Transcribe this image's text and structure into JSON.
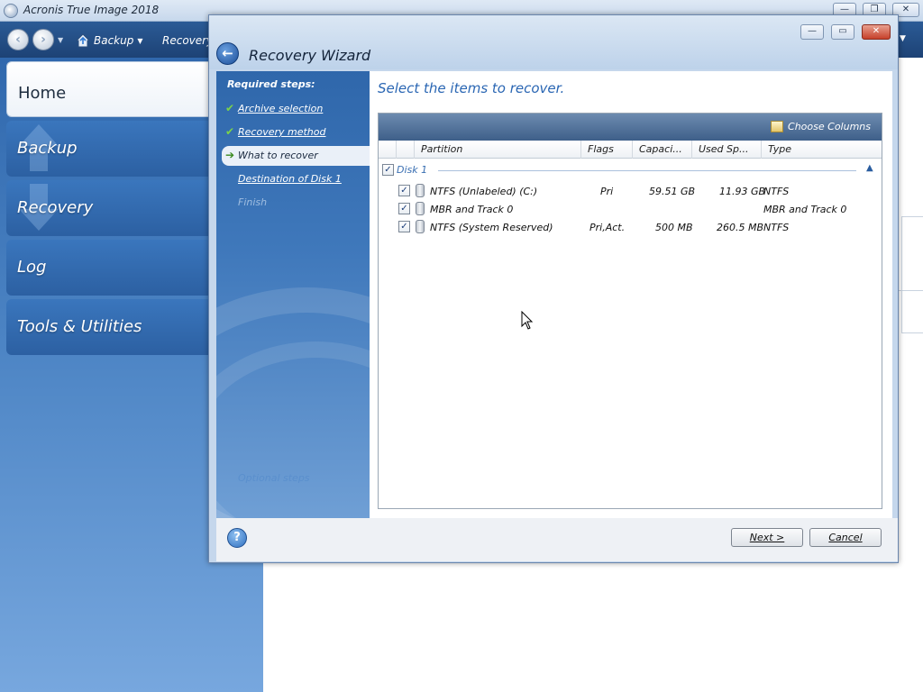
{
  "app": {
    "title": "Acronis True Image 2018",
    "toolbar": {
      "backup_label": "Backup",
      "recovery_label": "Recovery"
    },
    "sidebar": {
      "items": [
        {
          "label": "Home"
        },
        {
          "label": "Backup"
        },
        {
          "label": "Recovery"
        },
        {
          "label": "Log"
        },
        {
          "label": "Tools & Utilities"
        }
      ]
    }
  },
  "wizard": {
    "title": "Recovery Wizard",
    "steps_header": "Required steps:",
    "steps": [
      {
        "label": "Archive selection",
        "state": "done"
      },
      {
        "label": "Recovery method",
        "state": "done"
      },
      {
        "label": "What to recover",
        "state": "current"
      },
      {
        "label": "Destination of Disk 1",
        "state": "pending"
      },
      {
        "label": "Finish",
        "state": "disabled"
      }
    ],
    "optional_steps_label": "Optional steps",
    "heading": "Select the items to recover.",
    "choose_columns_label": "Choose Columns",
    "columns": [
      "Partition",
      "Flags",
      "Capaci...",
      "Used Sp...",
      "Type"
    ],
    "disk": {
      "label": "Disk 1",
      "checked": true
    },
    "partitions": [
      {
        "name": "NTFS (Unlabeled) (C:)",
        "flags": "Pri",
        "capacity": "59.51 GB",
        "used": "11.93 GB",
        "type": "NTFS",
        "checked": true
      },
      {
        "name": "MBR and Track 0",
        "flags": "",
        "capacity": "",
        "used": "",
        "type": "MBR and Track 0",
        "checked": true
      },
      {
        "name": "NTFS (System Reserved)",
        "flags": "Pri,Act.",
        "capacity": "500 MB",
        "used": "260.5 MB",
        "type": "NTFS",
        "checked": true
      }
    ],
    "buttons": {
      "next": "Next >",
      "cancel": "Cancel"
    }
  },
  "colors": {
    "toolbar": "#1d4275",
    "sidebar": "#3068ad",
    "heading": "#2a66b3",
    "close": "#c6402a"
  }
}
